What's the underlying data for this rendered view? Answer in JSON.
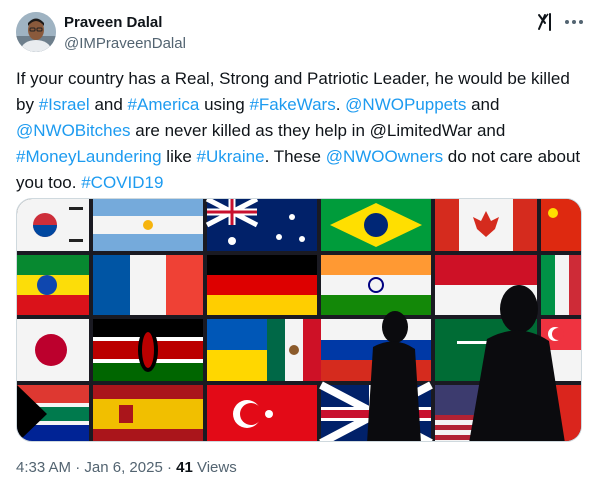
{
  "author": {
    "name": "Praveen Dalal",
    "handle": "@IMPraveenDalal"
  },
  "icons": {
    "grok": "grok-icon",
    "more": "more-horizontal-icon"
  },
  "tweet": {
    "segments": [
      {
        "text": "If your country has a Real, Strong and Patriotic Leader, he would be killed by ",
        "link": false
      },
      {
        "text": "#Israel",
        "link": true
      },
      {
        "text": " and ",
        "link": false
      },
      {
        "text": "#America",
        "link": true
      },
      {
        "text": " using ",
        "link": false
      },
      {
        "text": "#FakeWars",
        "link": true
      },
      {
        "text": ". ",
        "link": false
      },
      {
        "text": "@NWOPuppets",
        "link": true
      },
      {
        "text": " and ",
        "link": false
      },
      {
        "text": "@NWOBitches",
        "link": true
      },
      {
        "text": " are never killed as they help in @LimitedWar and ",
        "link": false
      },
      {
        "text": "#MoneyLaundering",
        "link": true
      },
      {
        "text": " like ",
        "link": false
      },
      {
        "text": "#Ukraine",
        "link": true
      },
      {
        "text": ". These ",
        "link": false
      },
      {
        "text": "@NWOOwners",
        "link": true
      },
      {
        "text": " do not care about you too. ",
        "link": false
      },
      {
        "text": "#COVID19",
        "link": true
      }
    ]
  },
  "meta": {
    "time": "4:33 AM",
    "separator1": " · ",
    "date": "Jan 6, 2025",
    "separator2": " · ",
    "views_count": "41",
    "views_label": " Views"
  },
  "colors": {
    "link": "#1d9bf0",
    "secondary_text": "#536471",
    "primary_text": "#0f1419"
  }
}
